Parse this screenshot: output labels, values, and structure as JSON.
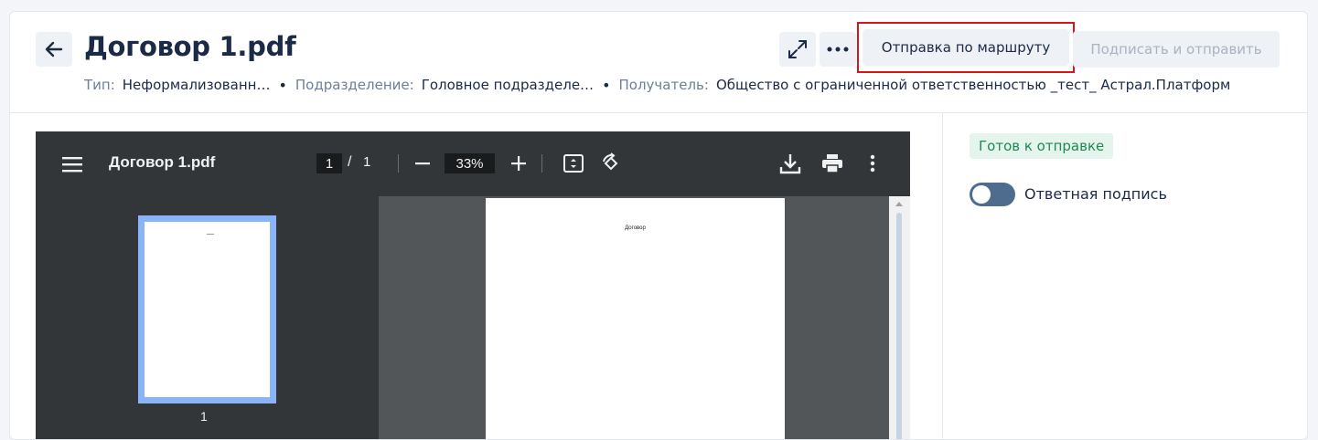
{
  "header": {
    "title": "Договор 1.pdf",
    "back_icon": "arrow-left-icon",
    "meta": {
      "type_label": "Тип:",
      "type_value": "Неформализованн…",
      "division_label": "Подразделение:",
      "division_value": "Головное подразделе…",
      "recipient_label": "Получатель:",
      "recipient_value": "Общество с ограниченной ответственностью _тест_ Астрал.Платформ",
      "separator": "•"
    },
    "actions": {
      "expand_icon": "expand-icon",
      "more_icon": "more-horizontal-icon",
      "route_label": "Отправка по маршруту",
      "sign_label": "Подписать и отправить"
    }
  },
  "viewer": {
    "filename": "Договор 1.pdf",
    "current_page": "1",
    "page_separator": "/",
    "total_pages": "1",
    "zoom": "33%",
    "thumbnail_label": "1",
    "document_heading": "Договор"
  },
  "panel": {
    "status": "Готов к отправке",
    "toggle_label": "Ответная подпись",
    "toggle_on": false
  },
  "colors": {
    "brand_text": "#1b2a47",
    "status_green": "#1e8a50",
    "highlight_red": "#d9141b",
    "viewer_toolbar": "#323639"
  }
}
